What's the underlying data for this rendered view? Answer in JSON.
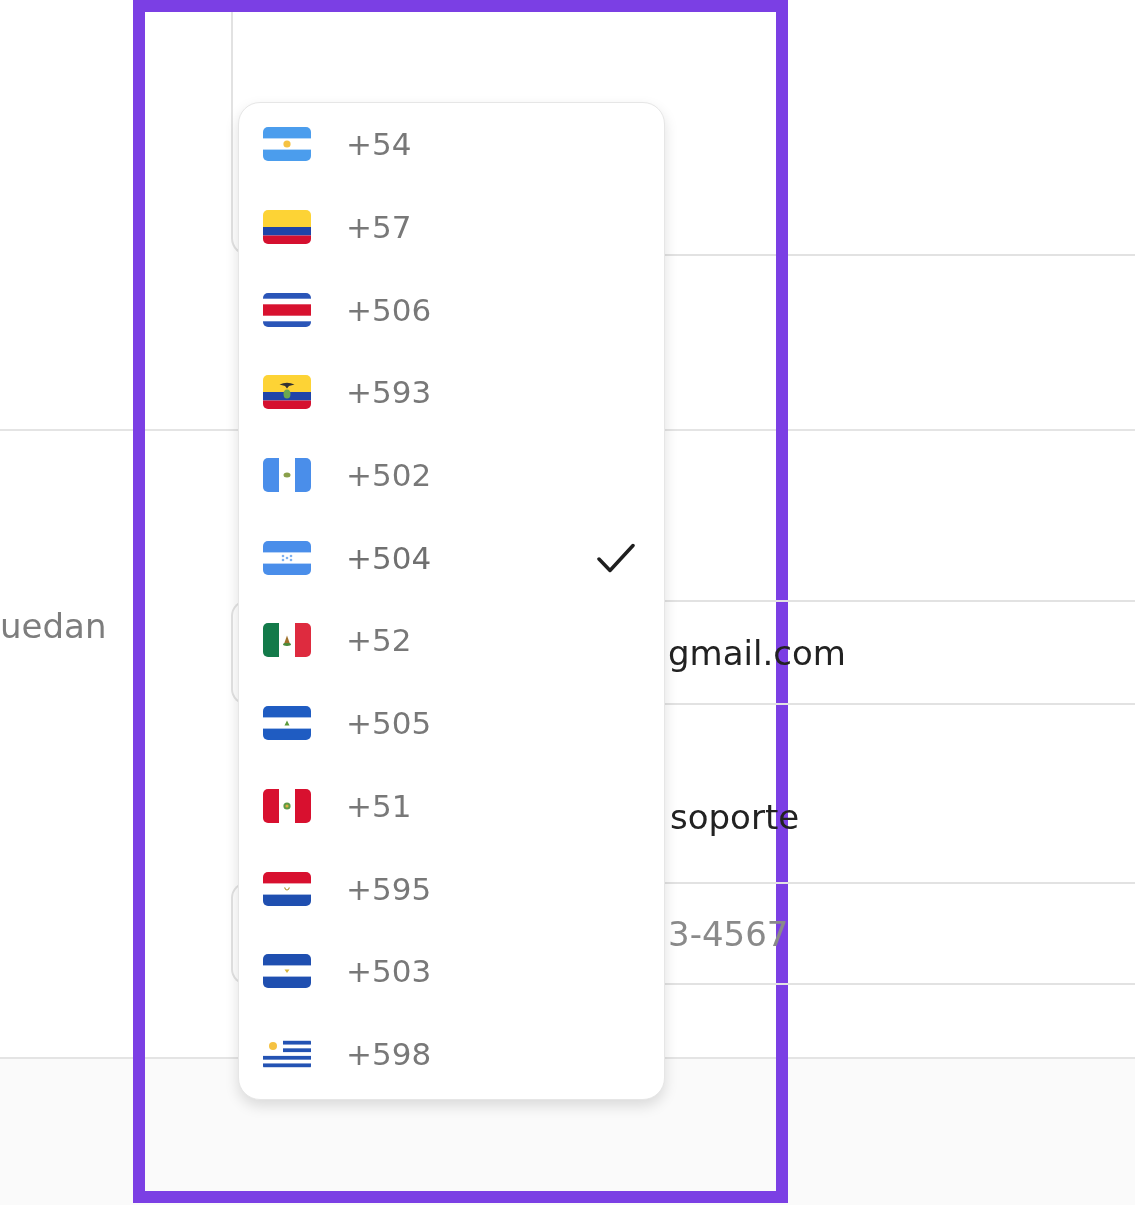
{
  "background_form": {
    "side_text": "uedan",
    "email_field": {
      "value": "gmail.com"
    },
    "support_label": "soporte",
    "phone_field": {
      "placeholder": "3-4567"
    }
  },
  "country_code_menu": {
    "options": [
      {
        "kind": "argentina",
        "code": "+54",
        "selected": false
      },
      {
        "kind": "colombia",
        "code": "+57",
        "selected": false
      },
      {
        "kind": "costa_rica",
        "code": "+506",
        "selected": false
      },
      {
        "kind": "ecuador",
        "code": "+593",
        "selected": false
      },
      {
        "kind": "guatemala",
        "code": "+502",
        "selected": false
      },
      {
        "kind": "honduras",
        "code": "+504",
        "selected": true
      },
      {
        "kind": "mexico",
        "code": "+52",
        "selected": false
      },
      {
        "kind": "nicaragua",
        "code": "+505",
        "selected": false
      },
      {
        "kind": "peru",
        "code": "+51",
        "selected": false
      },
      {
        "kind": "paraguay",
        "code": "+595",
        "selected": false
      },
      {
        "kind": "el_salvador",
        "code": "+503",
        "selected": false
      },
      {
        "kind": "uruguay",
        "code": "+598",
        "selected": false
      }
    ]
  }
}
